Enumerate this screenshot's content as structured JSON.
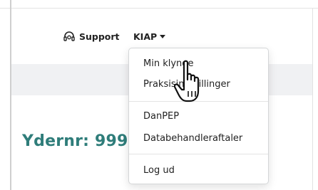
{
  "nav": {
    "support_label": "Support",
    "support_icon": "headset-icon",
    "kiap_label": "KIAP",
    "kiap_caret_icon": "caret-down-icon"
  },
  "page": {
    "heading_visible": "Ydernr: 999"
  },
  "dropdown": {
    "items": [
      {
        "label": "Min klynge"
      },
      {
        "label": "Praksisindstillinger"
      },
      {
        "label": "DanPEP"
      },
      {
        "label": "Databehandleraftaler"
      },
      {
        "label": "Log ud"
      }
    ]
  },
  "cursor": {
    "icon": "hand-pointer-icon"
  },
  "colors": {
    "heading": "#2f7d7a",
    "band": "#f0f1f3",
    "text": "#222222"
  }
}
